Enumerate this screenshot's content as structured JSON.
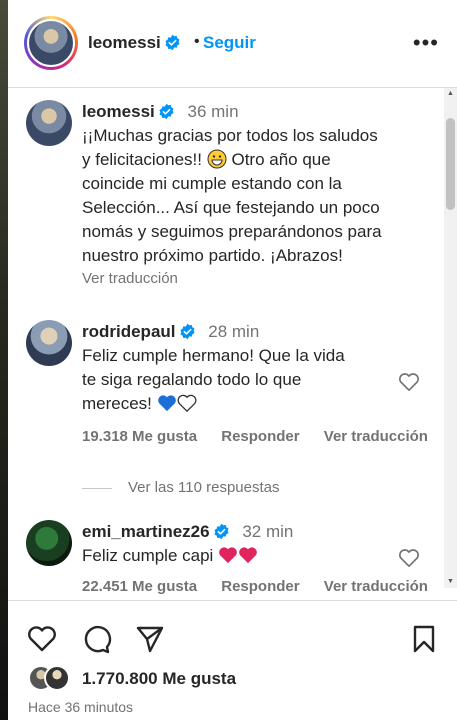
{
  "post_header": {
    "username": "leomessi",
    "separator": "•",
    "follow_label": "Seguir",
    "more_glyph": "•••"
  },
  "caption": {
    "username": "leomessi",
    "time": "36 min",
    "text_lines": [
      "¡¡Muchas gracias por todos los saludos",
      "y felicitaciones!!",
      "coincide mi cumple estando con la",
      "Selección... Así que festejando un poco",
      "nomás y seguimos preparándonos para",
      "nuestro próximo partido. ¡Abrazos!"
    ],
    "text_line2_tail": "Otro año que",
    "translate": "Ver traducción",
    "emoji_icon": "grinning-face-icon"
  },
  "comments": [
    {
      "username": "rodridepaul",
      "time": "28 min",
      "text_lines": [
        "Feliz cumple hermano! Que la vida",
        "te siga regalando todo lo que",
        "mereces!"
      ],
      "heart_icons": [
        "blue-heart-icon",
        "white-heart-icon"
      ],
      "likes": "19.318 Me gusta",
      "reply": "Responder",
      "translate": "Ver traducción",
      "view_replies": "Ver las 110 respuestas"
    },
    {
      "username": "emi_martinez26",
      "time": "32 min",
      "text": "Feliz cumple capi",
      "heart_icons": [
        "red-heart-icon",
        "red-heart-icon"
      ],
      "likes": "22.451 Me gusta",
      "reply": "Responder",
      "translate": "Ver traducción"
    }
  ],
  "actions": {
    "icons": [
      "heart-icon",
      "comment-icon",
      "share-icon",
      "bookmark-icon"
    ],
    "likes": "1.770.800 Me gusta",
    "time_ago": "Hace 36 minutos"
  },
  "colors": {
    "accent": "#0095f6",
    "verified": "#0095f6",
    "muted": "#737373",
    "text": "#262626",
    "red_heart": "#e0245e",
    "blue_heart": "#1d6fd8"
  }
}
